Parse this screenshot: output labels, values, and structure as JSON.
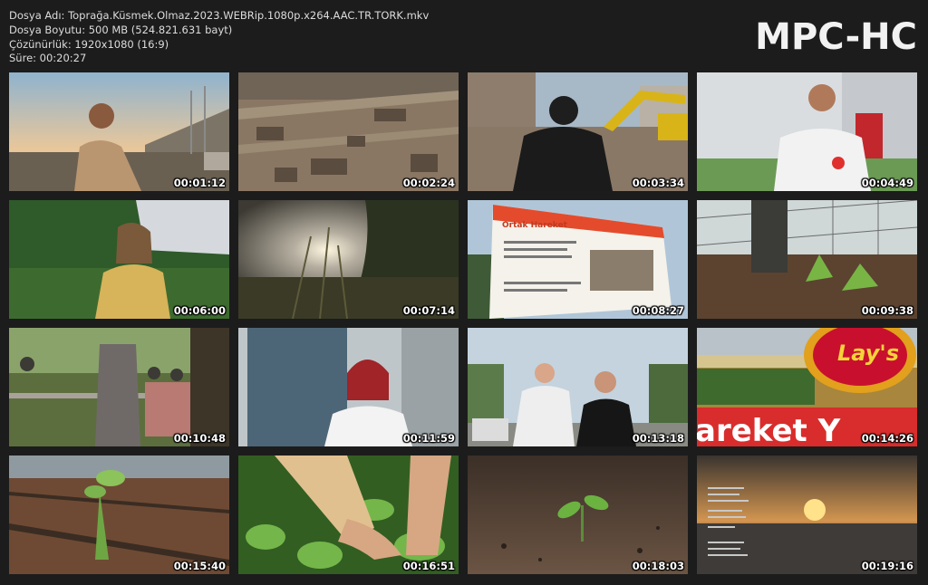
{
  "info": {
    "file_name": "Dosya Adı: Toprağa.Küsmek.Olmaz.2023.WEBRip.1080p.x264.AAC.TR.TORK.mkv",
    "file_size": "Dosya Boyutu: 500 MB (524.821.631 bayt)",
    "resolution": "Çözünürlük: 1920x1080 (16:9)",
    "duration": "Süre: 00:20:27"
  },
  "brand": "MPC-HC",
  "thumbnails": [
    {
      "time": "00:01:12",
      "scene": "man-by-sea"
    },
    {
      "time": "00:02:24",
      "scene": "aerial-rubble"
    },
    {
      "time": "00:03:34",
      "scene": "excavator-rubble"
    },
    {
      "time": "00:04:49",
      "scene": "man-white-shirt"
    },
    {
      "time": "00:06:00",
      "scene": "woman-greenhouse"
    },
    {
      "time": "00:07:14",
      "scene": "sunset-grass"
    },
    {
      "time": "00:08:27",
      "scene": "sign-board"
    },
    {
      "time": "00:09:38",
      "scene": "greenhouse-seedlings"
    },
    {
      "time": "00:10:48",
      "scene": "group-outdoors"
    },
    {
      "time": "00:11:59",
      "scene": "redhead-woman"
    },
    {
      "time": "00:13:18",
      "scene": "couple-street"
    },
    {
      "time": "00:14:26",
      "scene": "lays-sign"
    },
    {
      "time": "00:15:40",
      "scene": "seedling-drip"
    },
    {
      "time": "00:16:51",
      "scene": "hands-plants"
    },
    {
      "time": "00:18:03",
      "scene": "sprout-soil"
    },
    {
      "time": "00:19:16",
      "scene": "sunset-credits"
    }
  ],
  "sign": {
    "title": "Ortak Hareket"
  },
  "lays_sign": {
    "logo": "Lay's",
    "banner": "areket Y"
  }
}
